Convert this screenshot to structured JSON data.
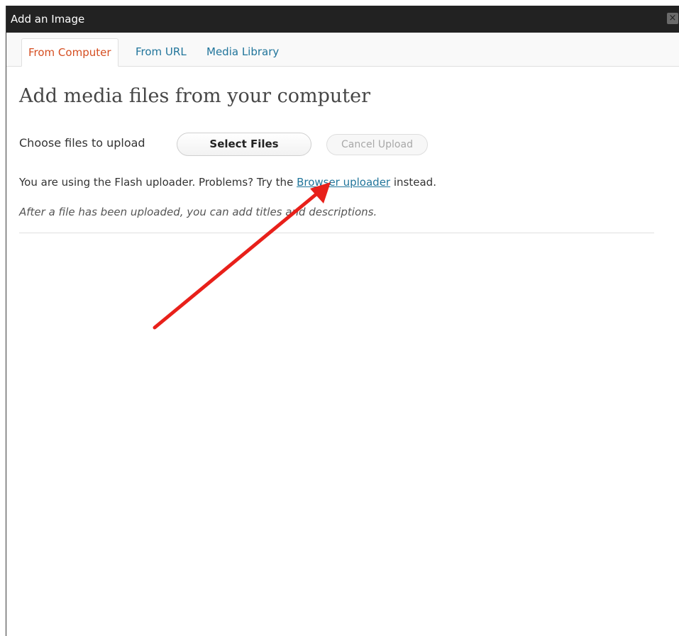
{
  "dialog": {
    "title": "Add an Image",
    "close_glyph": "×"
  },
  "tabs": [
    {
      "label": "From Computer",
      "active": true
    },
    {
      "label": "From URL",
      "active": false
    },
    {
      "label": "Media Library",
      "active": false
    }
  ],
  "main": {
    "heading": "Add media files from your computer",
    "choose_label": "Choose files to upload",
    "select_button": "Select Files",
    "cancel_button": "Cancel Upload",
    "flash_prefix": "You are using the Flash uploader. Problems? Try the ",
    "flash_link": "Browser uploader",
    "flash_suffix": " instead.",
    "after_note": "After a file has been uploaded, you can add titles and descriptions."
  },
  "annotation": {
    "arrow_color": "#e8201a"
  },
  "colors": {
    "titlebar": "#222222",
    "active_tab": "#d54e21",
    "link": "#21759b"
  }
}
